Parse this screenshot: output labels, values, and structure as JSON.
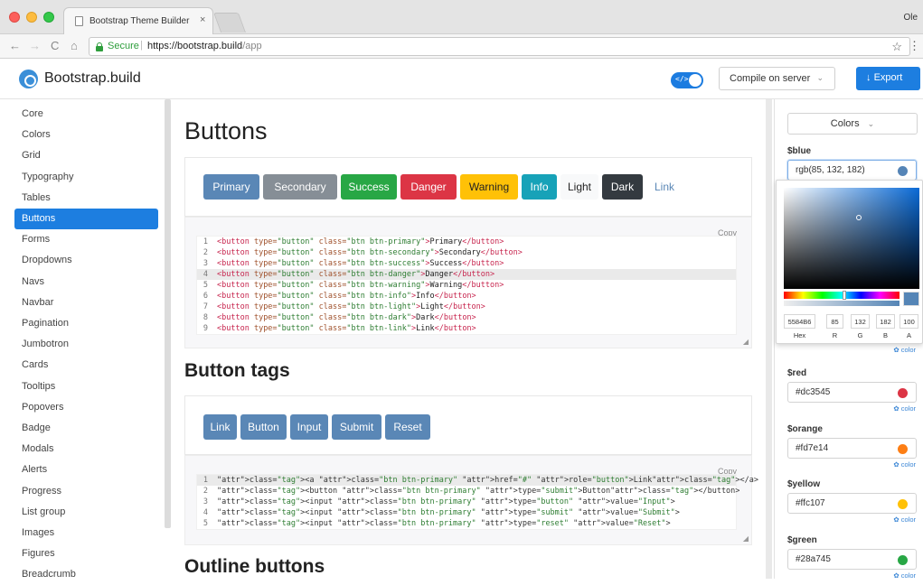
{
  "browser": {
    "tab_title": "Bootstrap Theme Builder - cre",
    "tab_close": "×",
    "profile": "Ole",
    "secure_label": "Secure",
    "url_host": "https://bootstrap.build",
    "url_path": "/app",
    "back": "←",
    "forward": "→",
    "reload": "C",
    "home": "⌂",
    "star": "☆",
    "menu": "⋮"
  },
  "header": {
    "brand": "Bootstrap.build",
    "toggle_code": "</>",
    "compile_label": "Compile on server",
    "compile_chevron": "⌄",
    "export_label": "Export",
    "export_icon": "↓"
  },
  "sidebar": {
    "items": [
      {
        "label": "Core"
      },
      {
        "label": "Colors"
      },
      {
        "label": "Grid"
      },
      {
        "label": "Typography"
      },
      {
        "label": "Tables"
      },
      {
        "label": "Buttons"
      },
      {
        "label": "Forms"
      },
      {
        "label": "Dropdowns"
      },
      {
        "label": "Navs"
      },
      {
        "label": "Navbar"
      },
      {
        "label": "Pagination"
      },
      {
        "label": "Jumbotron"
      },
      {
        "label": "Cards"
      },
      {
        "label": "Tooltips"
      },
      {
        "label": "Popovers"
      },
      {
        "label": "Badge"
      },
      {
        "label": "Modals"
      },
      {
        "label": "Alerts"
      },
      {
        "label": "Progress"
      },
      {
        "label": "List group"
      },
      {
        "label": "Images"
      },
      {
        "label": "Figures"
      },
      {
        "label": "Breadcrumb"
      }
    ],
    "active_index": 5
  },
  "main": {
    "title": "Buttons",
    "section1": {
      "buttons": [
        "Primary",
        "Secondary",
        "Success",
        "Danger",
        "Warning",
        "Info",
        "Light",
        "Dark",
        "Link"
      ],
      "copy": "Copy",
      "code": [
        {
          "n": "1",
          "variant": "btn-primary",
          "text": "Primary"
        },
        {
          "n": "2",
          "variant": "btn-secondary",
          "text": "Secondary"
        },
        {
          "n": "3",
          "variant": "btn-success",
          "text": "Success"
        },
        {
          "n": "4",
          "variant": "btn-danger",
          "text": "Danger"
        },
        {
          "n": "5",
          "variant": "btn-warning",
          "text": "Warning"
        },
        {
          "n": "6",
          "variant": "btn-info",
          "text": "Info"
        },
        {
          "n": "7",
          "variant": "btn-light",
          "text": "Light"
        },
        {
          "n": "8",
          "variant": "btn-dark",
          "text": "Dark"
        },
        {
          "n": "9",
          "variant": "btn-link",
          "text": "Link"
        }
      ],
      "highlight_line": 4
    },
    "section2": {
      "title": "Button tags",
      "buttons": [
        "Link",
        "Button",
        "Input",
        "Submit",
        "Reset"
      ],
      "copy": "Copy",
      "code": [
        "<a class=\"btn btn-primary\" href=\"#\" role=\"button\">Link</a>",
        "<button class=\"btn btn-primary\" type=\"submit\">Button</button>",
        "<input class=\"btn btn-primary\" type=\"button\" value=\"Input\">",
        "<input class=\"btn btn-primary\" type=\"submit\" value=\"Submit\">",
        "<input class=\"btn btn-primary\" type=\"reset\" value=\"Reset\">"
      ],
      "highlight_line": 1
    },
    "section3": {
      "title": "Outline buttons"
    }
  },
  "panel": {
    "select_label": "Colors",
    "select_chevron": "⌄",
    "color_link": "✿ color",
    "vars": [
      {
        "name": "$blue",
        "value": "rgb(85, 132, 182)",
        "swatch": "#5584b6"
      },
      {
        "name": "$red",
        "value": "#dc3545",
        "swatch": "#dc3545"
      },
      {
        "name": "$orange",
        "value": "#fd7e14",
        "swatch": "#fd7e14"
      },
      {
        "name": "$yellow",
        "value": "#ffc107",
        "swatch": "#ffc107"
      },
      {
        "name": "$green",
        "value": "#28a745",
        "swatch": "#28a745"
      }
    ],
    "picker": {
      "hex": "5584B6",
      "r": "85",
      "g": "132",
      "b": "182",
      "a": "100",
      "labels": [
        "Hex",
        "R",
        "G",
        "B",
        "A"
      ]
    }
  },
  "colors": {
    "accent": "#1d7ee0",
    "primary_button": "#5a87b6"
  }
}
